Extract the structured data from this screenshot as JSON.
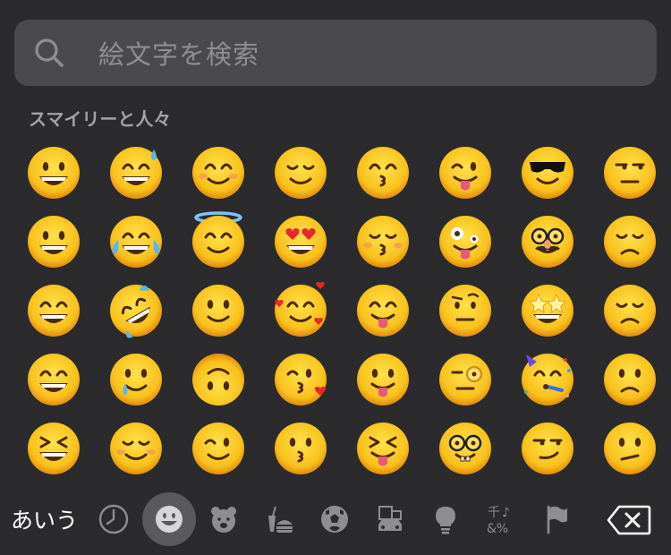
{
  "search": {
    "placeholder": "絵文字を検索",
    "icon": "search-icon"
  },
  "section": {
    "title": "スマイリーと人々"
  },
  "emoji_grid": [
    {
      "name": "grinning-face",
      "mouth": "grin",
      "eyes": "oval",
      "extra": ""
    },
    {
      "name": "grinning-face-with-sweat",
      "mouth": "grin",
      "eyes": "happy",
      "extra": "sweat"
    },
    {
      "name": "smiling-face-with-smiling-eyes",
      "mouth": "smile",
      "eyes": "happy",
      "extra": "blush"
    },
    {
      "name": "relieved-face",
      "mouth": "smile",
      "eyes": "closed",
      "extra": ""
    },
    {
      "name": "kissing-face-with-smiling-eyes",
      "mouth": "kiss",
      "eyes": "happy",
      "extra": ""
    },
    {
      "name": "winking-face-with-tongue",
      "mouth": "tongue",
      "eyes": "wink",
      "extra": ""
    },
    {
      "name": "smiling-face-with-sunglasses",
      "mouth": "smile",
      "eyes": "sunglasses",
      "extra": ""
    },
    {
      "name": "unamused-face",
      "mouth": "flat",
      "eyes": "side",
      "extra": ""
    },
    {
      "name": "grinning-face-with-big-eyes",
      "mouth": "grin",
      "eyes": "oval",
      "extra": ""
    },
    {
      "name": "face-with-tears-of-joy",
      "mouth": "grin",
      "eyes": "happy",
      "extra": "tears"
    },
    {
      "name": "smiling-face-with-halo",
      "mouth": "smile",
      "eyes": "happy",
      "extra": "halo"
    },
    {
      "name": "smiling-face-with-heart-eyes",
      "mouth": "grin",
      "eyes": "hearts",
      "extra": ""
    },
    {
      "name": "kissing-face-with-closed-eyes",
      "mouth": "kiss",
      "eyes": "closed",
      "extra": "blush"
    },
    {
      "name": "zany-face",
      "mouth": "tongue",
      "eyes": "zany",
      "extra": ""
    },
    {
      "name": "disguised-face",
      "mouth": "smile",
      "eyes": "glasses",
      "extra": "mustache"
    },
    {
      "name": "disappointed-face",
      "mouth": "frown",
      "eyes": "closed",
      "extra": ""
    },
    {
      "name": "grinning-squinting-face",
      "mouth": "grin",
      "eyes": "happy",
      "extra": ""
    },
    {
      "name": "rolling-on-the-floor-laughing",
      "mouth": "grin",
      "eyes": "happy",
      "extra": "tilt-tears"
    },
    {
      "name": "slightly-smiling-face",
      "mouth": "smile",
      "eyes": "oval",
      "extra": ""
    },
    {
      "name": "smiling-face-with-hearts",
      "mouth": "smile",
      "eyes": "happy",
      "extra": "hearts-around"
    },
    {
      "name": "face-savoring-food",
      "mouth": "tongue",
      "eyes": "happy",
      "extra": ""
    },
    {
      "name": "face-with-raised-eyebrow",
      "mouth": "flat",
      "eyes": "brow",
      "extra": ""
    },
    {
      "name": "star-struck",
      "mouth": "grin",
      "eyes": "stars",
      "extra": ""
    },
    {
      "name": "pensive-face",
      "mouth": "frown",
      "eyes": "closed",
      "extra": ""
    },
    {
      "name": "beaming-face-with-smiling-eyes",
      "mouth": "grin",
      "eyes": "happy",
      "extra": ""
    },
    {
      "name": "face-holding-back-tears",
      "mouth": "smile",
      "eyes": "oval",
      "extra": "tear"
    },
    {
      "name": "upside-down-face",
      "mouth": "smile",
      "eyes": "oval",
      "extra": "flip"
    },
    {
      "name": "face-blowing-a-kiss",
      "mouth": "kiss",
      "eyes": "wink",
      "extra": "heart"
    },
    {
      "name": "face-with-tongue",
      "mouth": "tongue",
      "eyes": "oval",
      "extra": ""
    },
    {
      "name": "face-with-monocle",
      "mouth": "flat",
      "eyes": "monocle",
      "extra": ""
    },
    {
      "name": "partying-face",
      "mouth": "horn",
      "eyes": "happy",
      "extra": "party"
    },
    {
      "name": "worried-face",
      "mouth": "frown",
      "eyes": "oval",
      "extra": ""
    },
    {
      "name": "grinning-squinting-face-xd",
      "mouth": "grin",
      "eyes": "squint",
      "extra": ""
    },
    {
      "name": "smiling-face",
      "mouth": "smile",
      "eyes": "closed",
      "extra": "blush"
    },
    {
      "name": "winking-face",
      "mouth": "smile",
      "eyes": "wink",
      "extra": ""
    },
    {
      "name": "kissing-face",
      "mouth": "kiss",
      "eyes": "oval",
      "extra": ""
    },
    {
      "name": "squinting-face-with-tongue",
      "mouth": "tongue",
      "eyes": "squint",
      "extra": ""
    },
    {
      "name": "nerd-face",
      "mouth": "teeth",
      "eyes": "glasses",
      "extra": ""
    },
    {
      "name": "smirking-face",
      "mouth": "smirk",
      "eyes": "side",
      "extra": ""
    },
    {
      "name": "confused-face",
      "mouth": "slant",
      "eyes": "oval",
      "extra": ""
    }
  ],
  "toolbar": {
    "keyboard_label": "あいう",
    "categories": [
      {
        "name": "recent-icon",
        "active": false
      },
      {
        "name": "smileys-icon",
        "active": true
      },
      {
        "name": "animals-icon",
        "active": false
      },
      {
        "name": "food-icon",
        "active": false
      },
      {
        "name": "activity-icon",
        "active": false
      },
      {
        "name": "travel-icon",
        "active": false
      },
      {
        "name": "objects-icon",
        "active": false
      },
      {
        "name": "symbols-icon",
        "active": false
      },
      {
        "name": "flags-icon",
        "active": false
      }
    ],
    "delete_icon": "delete-backspace-icon"
  },
  "colors": {
    "background": "#2b2b2d",
    "search_field": "#4a4a4d",
    "face": "#f9c11c",
    "face_shade": "#e48a0e",
    "feature": "#4a2a0a",
    "icon_gray": "#8e8e92"
  }
}
